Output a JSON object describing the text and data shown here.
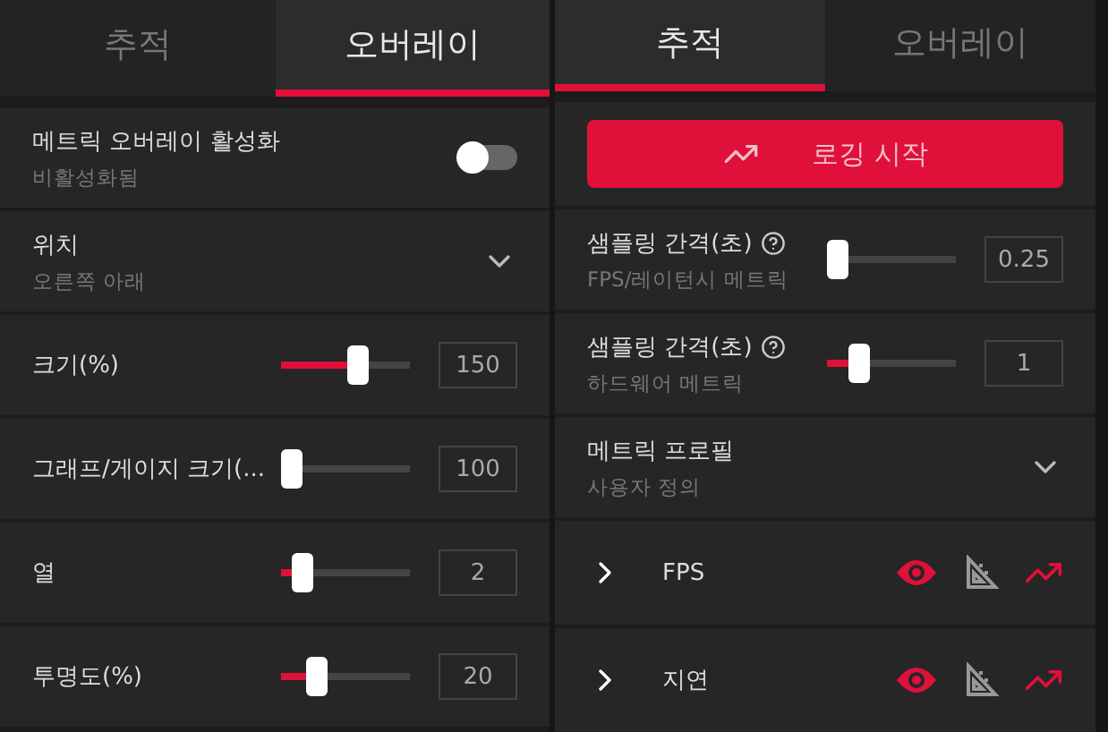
{
  "panels": [
    {
      "tabs": [
        {
          "label": "추적",
          "selected": false
        },
        {
          "label": "오버레이",
          "selected": true
        }
      ],
      "rows": [
        {
          "kind": "toggle",
          "label": "메트릭 오버레이 활성화",
          "sublabel": "비활성화됨",
          "on": false
        },
        {
          "kind": "dropdown",
          "label": "위치",
          "sublabel": "오른쪽 아래"
        },
        {
          "kind": "slider",
          "label": "크기(%)",
          "level": 0.62,
          "value": "150"
        },
        {
          "kind": "slider",
          "label": "그래프/게이지 크기(...",
          "level": 0,
          "value": "100"
        },
        {
          "kind": "slider",
          "label": "열",
          "level": 0.1,
          "value": "2"
        },
        {
          "kind": "slider",
          "label": "투명도(%)",
          "level": 0.24,
          "value": "20"
        }
      ]
    },
    {
      "tabs": [
        {
          "label": "추적",
          "selected": true
        },
        {
          "label": "오버레이",
          "selected": false
        }
      ],
      "rows": [
        {
          "kind": "button",
          "label": "로깅 시작"
        },
        {
          "kind": "slider",
          "label": "샘플링 간격(초)",
          "help": true,
          "sublabel": "FPS/레이턴시 메트릭",
          "level": 0,
          "value": "0.25"
        },
        {
          "kind": "slider",
          "label": "샘플링 간격(초)",
          "help": true,
          "sublabel": "하드웨어 메트릭",
          "level": 0.2,
          "value": "1"
        },
        {
          "kind": "dropdown",
          "label": "메트릭 프로필",
          "sublabel": "사용자 정의"
        },
        {
          "kind": "metric",
          "label": "FPS",
          "expanded": false,
          "visible": true,
          "measure": false,
          "log": true
        },
        {
          "kind": "metric",
          "label": "지연",
          "expanded": false,
          "visible": true,
          "measure": false,
          "log": true
        }
      ]
    }
  ]
}
